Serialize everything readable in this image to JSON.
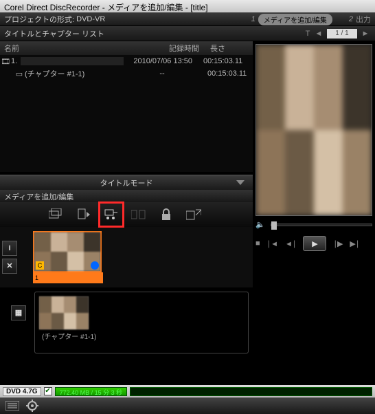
{
  "window": {
    "title": "Corel Direct DiscRecorder - メディアを追加/編集 - [title]"
  },
  "project": {
    "format_label": "プロジェクトの形式:",
    "format_value": "DVD-VR"
  },
  "steps": {
    "s1num": "1",
    "s1": "メディアを追加/編集",
    "s2num": "2",
    "s2": "出力"
  },
  "subheader": {
    "label": "タイトルとチャプター リスト",
    "pager": "1 / 1"
  },
  "columns": {
    "name": "名前",
    "recorded": "記録時間",
    "length": "長さ"
  },
  "rows": [
    {
      "icon": "🎞",
      "num": "1.",
      "name": "",
      "date": "2010/07/06 13:50",
      "length": "00:15:03.11"
    },
    {
      "icon": "▭",
      "num": "",
      "name": "(チャプター #1-1)",
      "date": "--",
      "length": "00:15:03.11"
    }
  ],
  "mode_bar": {
    "label": "タイトルモード"
  },
  "media": {
    "header": "メディアを追加/編集"
  },
  "icons": {
    "add_media": "add-media",
    "disc": "disc",
    "cart": "cart",
    "chapters": "chapters",
    "lock": "lock",
    "export": "export"
  },
  "clip1": {
    "strip": "1"
  },
  "chapter": {
    "caption": "(チャプター #1-1)"
  },
  "disk": {
    "label": "DVD 4.7G",
    "usage": "772.40 MB / 15 分 3 秒"
  }
}
